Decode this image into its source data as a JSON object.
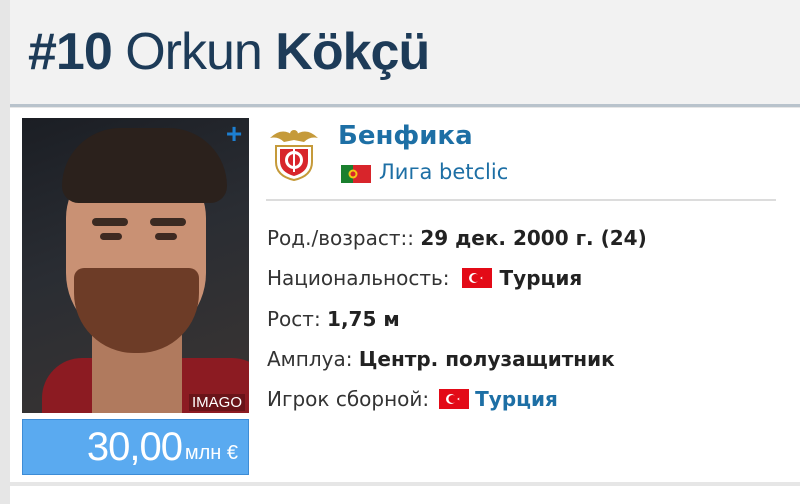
{
  "header": {
    "number": "#10",
    "first_name": "Orkun",
    "last_name": "Kökçü"
  },
  "photo": {
    "credit": "IMAGO",
    "add_icon": "plus-icon"
  },
  "market_value": {
    "amount": "30,00",
    "unit": "млн €"
  },
  "club": {
    "name": "Бенфика",
    "league": "Лига betclic",
    "league_flag": "portugal-flag",
    "logo_icon": "benfica-crest"
  },
  "info": {
    "birth": {
      "label": "Род./возраст::",
      "value": "29 дек. 2000 г. (24)"
    },
    "nationality": {
      "label": "Национальность:",
      "value": "Турция",
      "flag": "turkey-flag"
    },
    "height": {
      "label": "Рост:",
      "value": "1,75 м"
    },
    "position": {
      "label": "Амплуа:",
      "value": "Центр. полузащитник"
    },
    "national_team": {
      "label": "Игрок сборной:",
      "value": "Турция",
      "flag": "turkey-flag"
    }
  },
  "colors": {
    "header_text": "#1d3b58",
    "link": "#1d6fa5",
    "value_box": "#5aaaf0",
    "turkey_red": "#e30a17"
  }
}
